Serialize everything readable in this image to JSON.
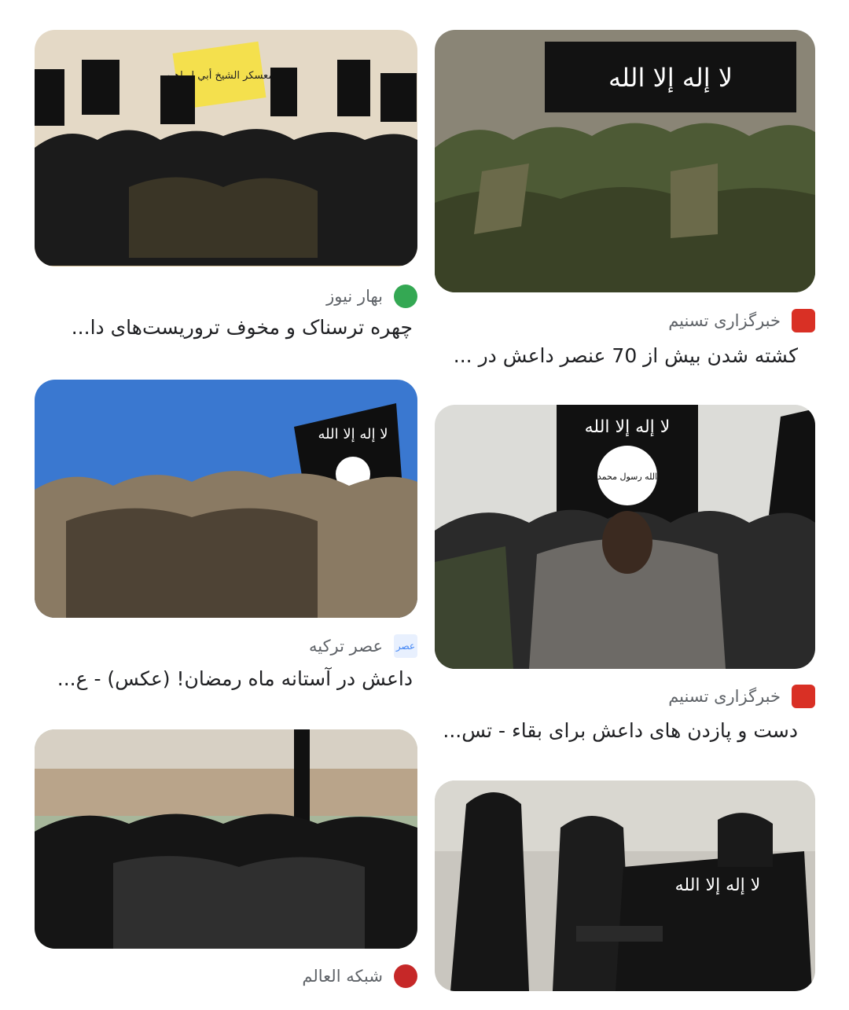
{
  "results": [
    {
      "source": "بهار نیوز",
      "title": "چهره ترسناک و مخوف تروریست‌های دا...",
      "logo_color": "#34a853",
      "logo_text": ""
    },
    {
      "source": "خبرگزاری تسنیم",
      "title": "کشته شدن بیش از 70 عنصر داعش در ...",
      "logo_color": "#d93025",
      "logo_text": ""
    },
    {
      "source": "عصر ترکیه",
      "title": "داعش در آستانه ماه رمضان! (عکس) - ع...",
      "logo_color": "#4285f4",
      "logo_text": "عصر"
    },
    {
      "source": "خبرگزاری تسنیم",
      "title": "دست و پازدن های داعش برای بقاء - تس...",
      "logo_color": "#d93025",
      "logo_text": ""
    },
    {
      "source": "شبکه العالم",
      "title": "",
      "logo_color": "#c62828",
      "logo_text": ""
    }
  ],
  "image_texts": {
    "shahada": "لا إله إلا الله",
    "seal": "الله رسول محمد",
    "banner": "معسكر الشيخ أبي إبراهيم"
  }
}
